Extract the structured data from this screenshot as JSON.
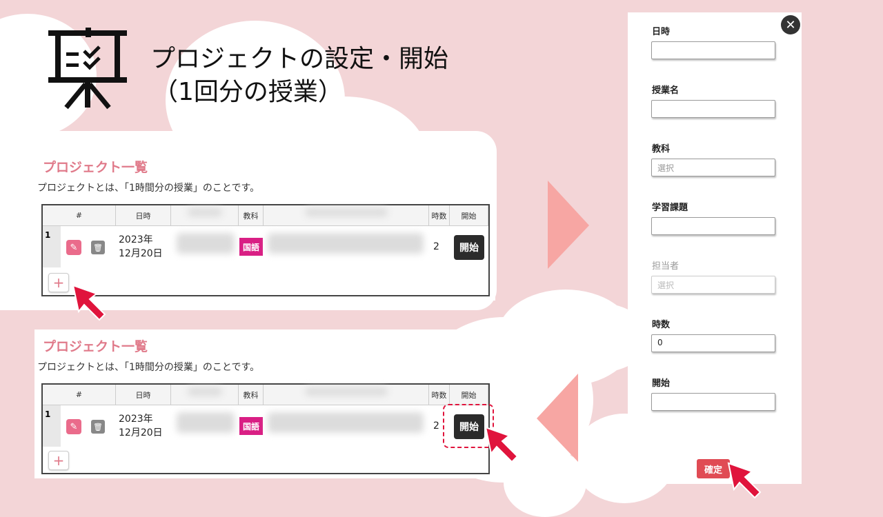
{
  "slide": {
    "title_line1": "プロジェクトの設定・開始",
    "title_line2": "（1回分の授業）"
  },
  "panel": {
    "title": "プロジェクト一覧",
    "description": "プロジェクトとは、「1時間分の授業」のことです。",
    "columns": [
      "#",
      "日時",
      "教科",
      "時数",
      "開始"
    ],
    "row": {
      "number": "1",
      "date_line1": "2023年",
      "date_line2": "12月20日",
      "subject": "国語",
      "hours": "2",
      "start_label": "開始"
    },
    "add_label": "+"
  },
  "form": {
    "fields": [
      {
        "label": "日時",
        "value": "",
        "placeholder": ""
      },
      {
        "label": "授業名",
        "value": "",
        "placeholder": ""
      },
      {
        "label": "教科",
        "value": "",
        "placeholder": "選択"
      },
      {
        "label": "学習課題",
        "value": "",
        "placeholder": ""
      },
      {
        "label": "担当者",
        "value": "",
        "placeholder": "選択"
      },
      {
        "label": "時数",
        "value": "0",
        "placeholder": ""
      },
      {
        "label": "開始",
        "value": "",
        "placeholder": ""
      }
    ],
    "close_label": "✕",
    "confirm_label": "確定"
  },
  "colors": {
    "accent_pink": "#e07a8a",
    "subject_badge": "#d91f84",
    "arrow_red": "#e0143c",
    "background": "#f3d5d7"
  },
  "icons": [
    "presentation-board-icon",
    "edit-icon",
    "trash-icon",
    "close-icon",
    "pointer-arrow-icon"
  ]
}
